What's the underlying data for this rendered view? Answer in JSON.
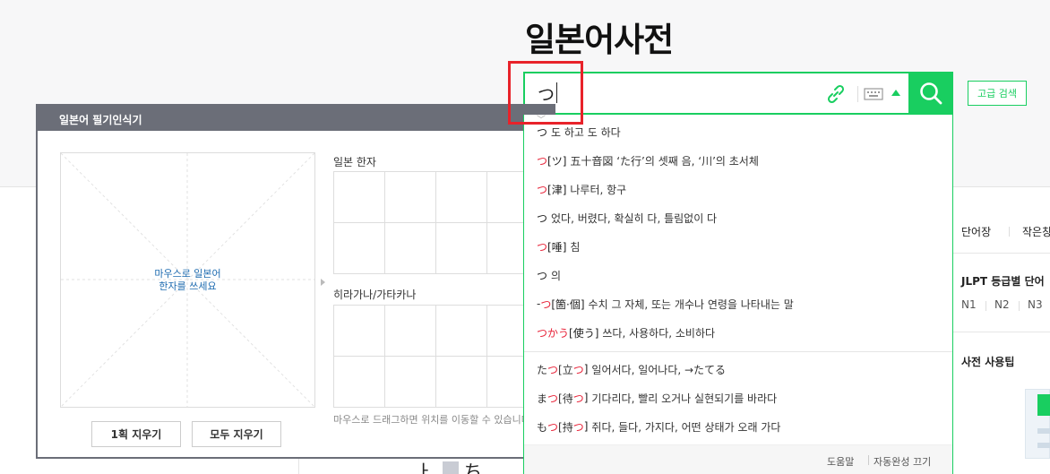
{
  "page": {
    "title": "일본어사전"
  },
  "search": {
    "value": "つ",
    "advanced_label": "고급 검색",
    "icons": {
      "link": "link-icon",
      "keyboard": "keyboard-icon",
      "toggle": "caret-up-icon",
      "search": "search-icon"
    }
  },
  "autocomplete": {
    "items": [
      {
        "word": "つ",
        "word_hl": "つ",
        "bracket": "",
        "desc": "도 하고 도 하다"
      },
      {
        "word": "つ[ツ]",
        "word_hl": "つ",
        "bracket": "[ツ]",
        "desc": "五十音図 ‘た行’의 셋째 음, ‘川’의 초서체"
      },
      {
        "word": "つ[津]",
        "word_hl": "つ",
        "bracket": "[津]",
        "desc": "나루터, 항구"
      },
      {
        "word": "つ",
        "word_hl": "つ",
        "bracket": "",
        "desc": "었다, 버렸다, 확실히 다, 틀림없이 다"
      },
      {
        "word": "つ[唾]",
        "word_hl": "つ",
        "bracket": "[唾]",
        "desc": "침"
      },
      {
        "word": "つ",
        "word_hl": "つ",
        "bracket": "",
        "desc": "의"
      },
      {
        "word": "-つ[箇·個]",
        "word_pre": "-",
        "word_hl": "つ",
        "bracket": "[箇·個]",
        "desc": "수치 그 자체, 또는 개수나 연령을 나타내는 말"
      },
      {
        "word": "つかう[使う]",
        "word_hl": "つかう",
        "bracket": "[使う]",
        "desc": "쓰다, 사용하다, 소비하다"
      }
    ],
    "items2": [
      {
        "pre": "た",
        "hl": "つ",
        "mid": "[立",
        "hl2": "つ",
        "post": "]",
        "desc": "일어서다, 일어나다, →たてる"
      },
      {
        "pre": "ま",
        "hl": "つ",
        "mid": "[待",
        "hl2": "つ",
        "post": "]",
        "desc": "기다리다, 빨리 오거나 실현되기를 바라다"
      },
      {
        "pre": "も",
        "hl": "つ",
        "mid": "[持",
        "hl2": "つ",
        "post": "]",
        "desc": "쥐다, 들다, 가지다, 어떤 상태가 오래 가다"
      }
    ],
    "footer": {
      "help": "도움말",
      "off": "자동완성 끄기"
    }
  },
  "handwriting": {
    "title": "일본어 필기인식기",
    "canvas_hint_1": "마우스로 일본어",
    "canvas_hint_2": "한자를 쓰세요",
    "kanji_label": "일본 한자",
    "kana_label": "히라가나/가타카나",
    "undo_label": "1획 지우기",
    "clear_label": "모두 지우기",
    "drag_hint": "마우스로 드래그하면 위치를 이동할 수 있습니다."
  },
  "sidebar": {
    "wordbook": "단어장",
    "small": "작은창",
    "jlpt_title": "JLPT 등급별 단어",
    "levels": [
      "N1",
      "N2",
      "N3"
    ],
    "tips": "사전 사용팁"
  },
  "bottom": {
    "kana": "ㅏ",
    "kana2": "ち"
  },
  "colors": {
    "accent": "#19ce60",
    "highlight": "#e82238",
    "panel_title": "#6b6e78",
    "annotation": "#e8222a"
  }
}
